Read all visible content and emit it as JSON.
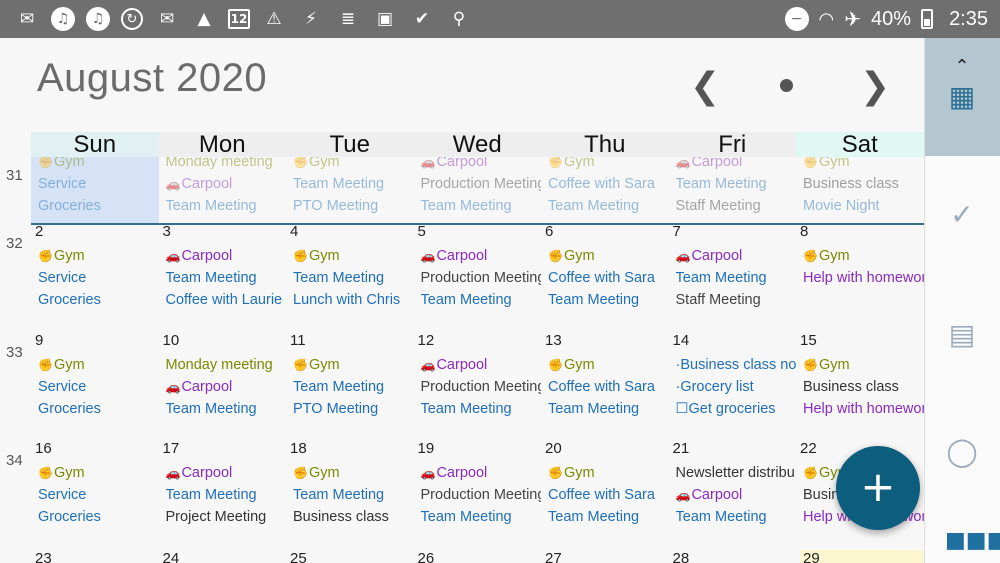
{
  "status": {
    "icons": [
      "mail-icon",
      "music-icon",
      "music-icon",
      "sync-icon",
      "gmail-icon",
      "drive-icon",
      "calendar-12-icon",
      "warning-icon",
      "flash-icon",
      "stack-icon",
      "image-icon",
      "check-icon",
      "lock-icon"
    ],
    "calendar_day": "12",
    "battery": "40%",
    "time": "2:35"
  },
  "header": {
    "title": "August 2020"
  },
  "days": [
    "Sun",
    "Mon",
    "Tue",
    "Wed",
    "Thu",
    "Fri",
    "Sat"
  ],
  "weeks": [
    {
      "num": "31",
      "faded": true,
      "cells": [
        {
          "date": "",
          "events": [
            [
              "Gym",
              "c-green"
            ],
            [
              "Service",
              "c-blue"
            ],
            [
              "Groceries",
              "c-blue"
            ]
          ]
        },
        {
          "date": "",
          "events": [
            [
              "Monday meeting",
              "c-green"
            ],
            [
              "Carpool",
              "c-purple"
            ],
            [
              "Team Meeting",
              "c-blue"
            ]
          ]
        },
        {
          "date": "",
          "events": [
            [
              "Gym",
              "c-green"
            ],
            [
              "Team Meeting",
              "c-blue"
            ],
            [
              "PTO Meeting",
              "c-blue"
            ]
          ]
        },
        {
          "date": "",
          "events": [
            [
              "Carpool",
              "c-purple"
            ],
            [
              "Production Meeting",
              "c-gray"
            ],
            [
              "Team Meeting",
              "c-blue"
            ]
          ]
        },
        {
          "date": "",
          "events": [
            [
              "Gym",
              "c-green"
            ],
            [
              "Coffee with Sara",
              "c-blue"
            ],
            [
              "Team Meeting",
              "c-blue"
            ]
          ]
        },
        {
          "date": "",
          "events": [
            [
              "Carpool",
              "c-purple"
            ],
            [
              "Team Meeting",
              "c-blue"
            ],
            [
              "Staff Meeting",
              "c-gray"
            ]
          ]
        },
        {
          "date": "",
          "events": [
            [
              "Gym",
              "c-green"
            ],
            [
              "Business class",
              "c-dark"
            ],
            [
              "Movie Night",
              "c-blue"
            ]
          ]
        }
      ]
    },
    {
      "num": "32",
      "faded": false,
      "cells": [
        {
          "date": "2",
          "events": [
            [
              "Gym",
              "c-green"
            ],
            [
              "Service",
              "c-blue"
            ],
            [
              "Groceries",
              "c-blue"
            ]
          ]
        },
        {
          "date": "3",
          "events": [
            [
              "Carpool",
              "c-purple"
            ],
            [
              "Team Meeting",
              "c-blue"
            ],
            [
              "Coffee with Laurie",
              "c-blue"
            ]
          ]
        },
        {
          "date": "4",
          "events": [
            [
              "Gym",
              "c-green"
            ],
            [
              "Team Meeting",
              "c-blue"
            ],
            [
              "Lunch with Chris",
              "c-blue"
            ]
          ]
        },
        {
          "date": "5",
          "events": [
            [
              "Carpool",
              "c-purple"
            ],
            [
              "Production Meeting",
              "c-gray"
            ],
            [
              "Team Meeting",
              "c-blue"
            ]
          ]
        },
        {
          "date": "6",
          "events": [
            [
              "Gym",
              "c-green"
            ],
            [
              "Coffee with Sara",
              "c-blue"
            ],
            [
              "Team Meeting",
              "c-blue"
            ]
          ]
        },
        {
          "date": "7",
          "events": [
            [
              "Carpool",
              "c-purple"
            ],
            [
              "Team Meeting",
              "c-blue"
            ],
            [
              "Staff Meeting",
              "c-gray"
            ]
          ]
        },
        {
          "date": "8",
          "events": [
            [
              "Gym",
              "c-green"
            ],
            [
              "Help with homework",
              "c-purple"
            ]
          ]
        }
      ]
    },
    {
      "num": "33",
      "faded": false,
      "cells": [
        {
          "date": "9",
          "events": [
            [
              "Gym",
              "c-green"
            ],
            [
              "Service",
              "c-blue"
            ],
            [
              "Groceries",
              "c-blue"
            ]
          ]
        },
        {
          "date": "10",
          "events": [
            [
              "Monday meeting",
              "c-green"
            ],
            [
              "Carpool",
              "c-purple"
            ],
            [
              "Team Meeting",
              "c-blue"
            ]
          ]
        },
        {
          "date": "11",
          "events": [
            [
              "Gym",
              "c-green"
            ],
            [
              "Team Meeting",
              "c-blue"
            ],
            [
              "PTO Meeting",
              "c-blue"
            ]
          ]
        },
        {
          "date": "12",
          "events": [
            [
              "Carpool",
              "c-purple"
            ],
            [
              "Production Meeting",
              "c-gray"
            ],
            [
              "Team Meeting",
              "c-blue"
            ]
          ]
        },
        {
          "date": "13",
          "events": [
            [
              "Gym",
              "c-green"
            ],
            [
              "Coffee with Sara",
              "c-blue"
            ],
            [
              "Team Meeting",
              "c-blue"
            ]
          ]
        },
        {
          "date": "14",
          "events": [
            [
              "·Business class no",
              "c-blue"
            ],
            [
              "·Grocery list",
              "c-blue"
            ],
            [
              "☐Get groceries",
              "c-blue"
            ]
          ]
        },
        {
          "date": "15",
          "events": [
            [
              "Gym",
              "c-green"
            ],
            [
              "Business class",
              "c-dark"
            ],
            [
              "Help with homework",
              "c-purple"
            ]
          ]
        }
      ]
    },
    {
      "num": "34",
      "faded": false,
      "cells": [
        {
          "date": "16",
          "events": [
            [
              "Gym",
              "c-green"
            ],
            [
              "Service",
              "c-blue"
            ],
            [
              "Groceries",
              "c-blue"
            ]
          ]
        },
        {
          "date": "17",
          "events": [
            [
              "Carpool",
              "c-purple"
            ],
            [
              "Team Meeting",
              "c-blue"
            ],
            [
              "Project Meeting",
              "c-dark"
            ]
          ]
        },
        {
          "date": "18",
          "events": [
            [
              "Gym",
              "c-green"
            ],
            [
              "Team Meeting",
              "c-blue"
            ],
            [
              "Business class",
              "c-dark"
            ]
          ]
        },
        {
          "date": "19",
          "events": [
            [
              "Carpool",
              "c-purple"
            ],
            [
              "Production Meeting",
              "c-gray"
            ],
            [
              "Team Meeting",
              "c-blue"
            ]
          ]
        },
        {
          "date": "20",
          "events": [
            [
              "Gym",
              "c-green"
            ],
            [
              "Coffee with Sara",
              "c-blue"
            ],
            [
              "Team Meeting",
              "c-blue"
            ]
          ]
        },
        {
          "date": "21",
          "events": [
            [
              "Newsletter distribu",
              "c-dark"
            ],
            [
              "Carpool",
              "c-purple"
            ],
            [
              "Team Meeting",
              "c-blue"
            ]
          ]
        },
        {
          "date": "22",
          "events": [
            [
              "Gym",
              "c-green"
            ],
            [
              "Business class",
              "c-dark"
            ],
            [
              "Help with homework",
              "c-purple"
            ]
          ]
        }
      ]
    }
  ],
  "next_row_dates": [
    "23",
    "24",
    "25",
    "26",
    "27",
    "28",
    "29"
  ]
}
